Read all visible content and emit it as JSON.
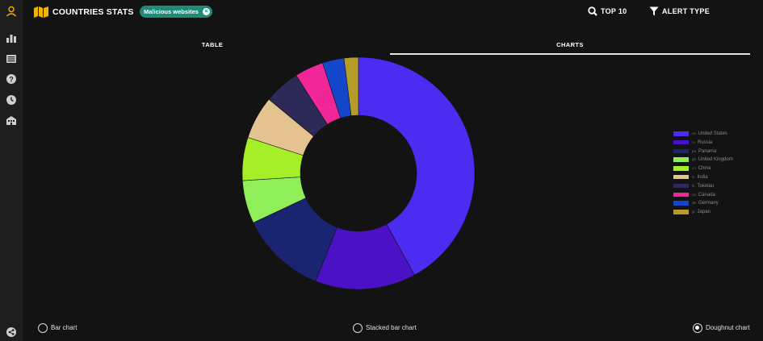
{
  "header": {
    "title": "COUNTRIES STATS",
    "filter_chip": "Malicious websites",
    "top10_label": "TOP 10",
    "alert_type_label": "ALERT TYPE"
  },
  "sidebar": {
    "items": [
      "user-icon",
      "bar-chart-icon",
      "list-icon",
      "help-icon",
      "clock-icon",
      "building-icon",
      "share-icon"
    ]
  },
  "tabs": [
    {
      "label": "TABLE",
      "active": false
    },
    {
      "label": "CHARTS",
      "active": true
    }
  ],
  "chart_data": {
    "type": "doughnut",
    "categories": [
      "United States",
      "Russia",
      "Panama",
      "United Kingdom",
      "China",
      "India",
      "Tokelau",
      "Canada",
      "Germany",
      "Japan"
    ],
    "codes": [
      "us",
      "ru",
      "pa",
      "gb",
      "cn",
      "in",
      "tk",
      "ca",
      "de",
      "jp"
    ],
    "values": [
      42,
      14,
      12,
      6,
      6,
      6,
      5,
      4,
      3,
      2
    ],
    "colors": [
      "#4c2cf0",
      "#4a12c4",
      "#1a2470",
      "#90ee59",
      "#a6ef28",
      "#e4c390",
      "#2e2a58",
      "#f22797",
      "#1446cc",
      "#b59b2a"
    ],
    "legend_position": "right"
  },
  "chart_types": {
    "options": [
      "Bar chart",
      "Stacked bar chart",
      "Doughnut chart"
    ],
    "selected": "Doughnut chart"
  }
}
